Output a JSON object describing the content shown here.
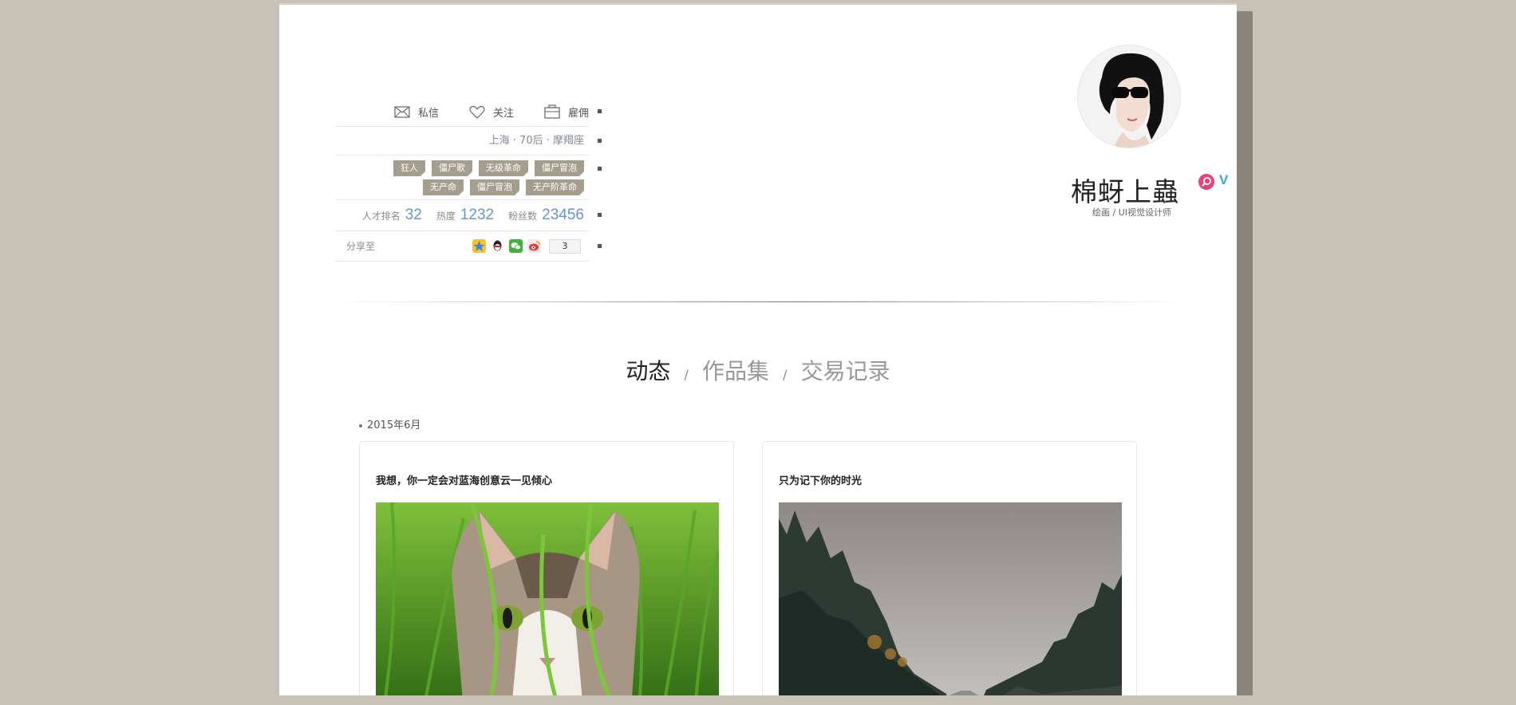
{
  "profile": {
    "actions": [
      {
        "label": "私信",
        "icon": "mail-icon"
      },
      {
        "label": "关注",
        "icon": "heart-icon"
      },
      {
        "label": "雇佣",
        "icon": "briefcase-icon"
      }
    ],
    "location": "上海 · 70后 · 摩羯座",
    "tags_row1": [
      "狂人",
      "僵尸歌",
      "无级革命",
      "僵尸冒泡"
    ],
    "tags_row2": [
      "无产命",
      "僵尸冒泡",
      "无产阶革命"
    ],
    "stats": [
      {
        "label": "人才排名",
        "value": "32"
      },
      {
        "label": "热度",
        "value": "1232"
      },
      {
        "label": "粉丝数",
        "value": "23456"
      }
    ],
    "share": {
      "label": "分享至",
      "count": "3",
      "icons": [
        "qzone-icon",
        "qq-icon",
        "wechat-icon",
        "weibo-icon"
      ]
    },
    "name": "棉蚜上蟲",
    "role": "绘画 / UI视觉设计师"
  },
  "tabs": [
    {
      "label": "动态",
      "active": true
    },
    {
      "label": "作品集",
      "active": false
    },
    {
      "label": "交易记录",
      "active": false
    }
  ],
  "tab_separator": "/",
  "timeline": {
    "date": "2015年6月",
    "cards": [
      {
        "title": "我想，你一定会对蓝海创意云一见倾心",
        "image": "cat-in-grass-photo"
      },
      {
        "title": "只为记下你的时光",
        "image": "misty-forest-road-photo"
      }
    ]
  },
  "colors": {
    "background": "#c8c2b6",
    "tag": "#a59e8e",
    "stat_number": "#6a93d1",
    "location_text": "#7f8a97"
  }
}
